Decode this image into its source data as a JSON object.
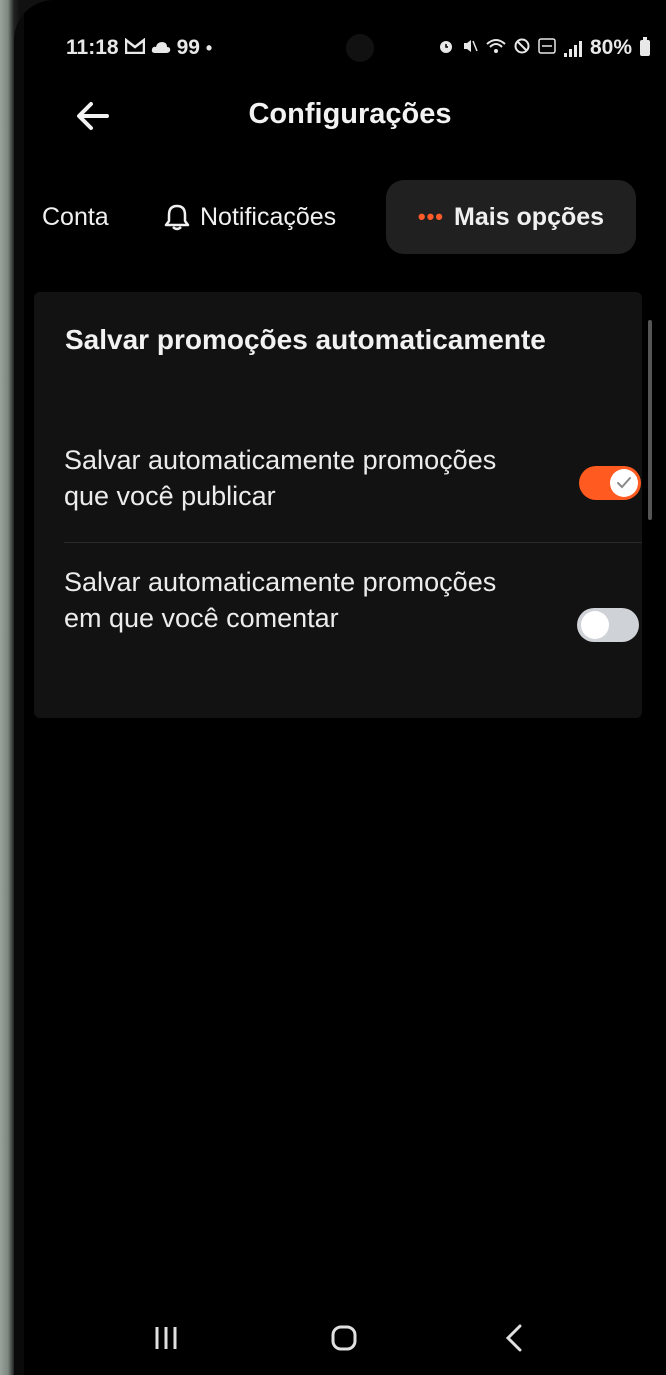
{
  "status_bar": {
    "time": "11:18",
    "notification_count": "99",
    "battery": "80%",
    "icons": [
      "gmail-icon",
      "cloud-icon",
      "alarm-icon",
      "mute-icon",
      "wifi-icon",
      "dnd-icon",
      "volte-icon",
      "signal-icon",
      "battery-icon"
    ]
  },
  "header": {
    "title": "Configurações",
    "back_icon": "arrow-left-icon"
  },
  "tabs": [
    {
      "label": "Conta"
    },
    {
      "label": "Notificações",
      "icon": "bell-icon"
    },
    {
      "label": "Mais opções",
      "icon": "dots-icon",
      "selected": true
    }
  ],
  "settings": {
    "section_title": "Salvar promoções automaticamente",
    "items": [
      {
        "label": "Salvar automaticamente promoções que você publicar",
        "enabled": true
      },
      {
        "label": "Salvar automaticamente promoções em que você comentar",
        "enabled": false
      }
    ]
  },
  "navbar": {
    "icons": [
      "recent-apps-icon",
      "home-icon",
      "back-icon"
    ]
  },
  "colors": {
    "accent": "#ff5a1f",
    "background": "#000000",
    "card": "#121212",
    "selected_tab": "#202020"
  }
}
